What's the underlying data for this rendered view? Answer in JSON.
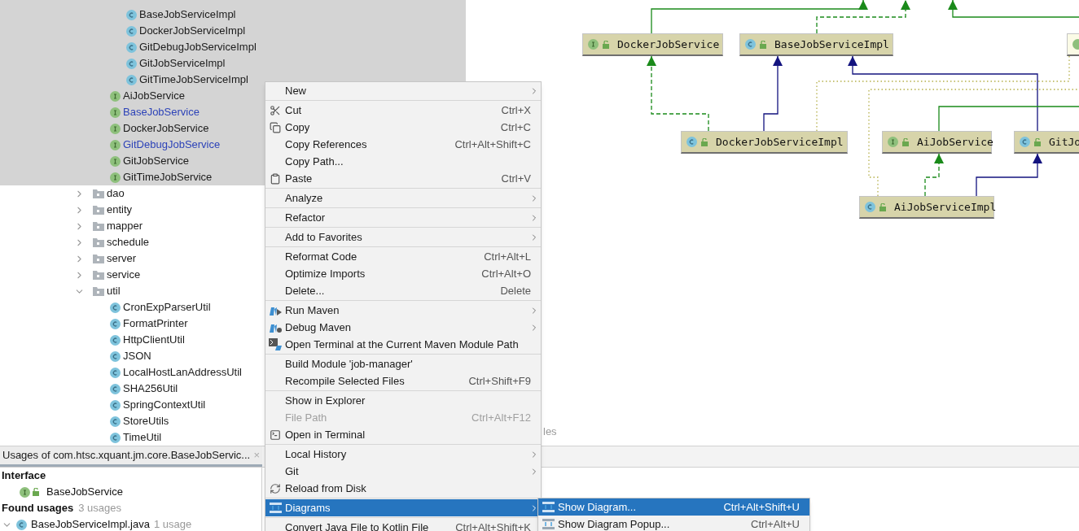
{
  "project_tree": {
    "items": [
      {
        "kind": "continuation",
        "children": [
          {
            "kind": "continuation",
            "children": [
              {
                "kind": "class",
                "label": "BaseJobServiceImpl",
                "selected": true,
                "modified": false
              },
              {
                "kind": "class",
                "label": "DockerJobServiceImpl",
                "selected": true,
                "modified": false
              },
              {
                "kind": "class",
                "label": "GitDebugJobServiceImpl",
                "selected": true,
                "modified": false
              },
              {
                "kind": "class",
                "label": "GitJobServiceImpl",
                "selected": true,
                "modified": false
              },
              {
                "kind": "class",
                "label": "GitTimeJobServiceImpl",
                "selected": true,
                "modified": false
              }
            ]
          },
          {
            "kind": "interface",
            "label": "AiJobService",
            "selected": true,
            "modified": false
          },
          {
            "kind": "interface",
            "label": "BaseJobService",
            "selected": true,
            "modified": true
          },
          {
            "kind": "interface",
            "label": "DockerJobService",
            "selected": true,
            "modified": false
          },
          {
            "kind": "interface",
            "label": "GitDebugJobService",
            "selected": true,
            "modified": true
          },
          {
            "kind": "interface",
            "label": "GitJobService",
            "selected": true,
            "modified": false
          },
          {
            "kind": "interface",
            "label": "GitTimeJobService",
            "selected": true,
            "modified": false
          }
        ]
      },
      {
        "kind": "folder",
        "label": "dao",
        "expanded": false,
        "selected": false,
        "modified": false
      },
      {
        "kind": "folder",
        "label": "entity",
        "expanded": false,
        "selected": false,
        "modified": false
      },
      {
        "kind": "folder",
        "label": "mapper",
        "expanded": false,
        "selected": false,
        "modified": false
      },
      {
        "kind": "folder",
        "label": "schedule",
        "expanded": false,
        "selected": false,
        "modified": false
      },
      {
        "kind": "folder",
        "label": "server",
        "expanded": false,
        "selected": false,
        "modified": false
      },
      {
        "kind": "folder",
        "label": "service",
        "expanded": false,
        "selected": false,
        "modified": false
      },
      {
        "kind": "folder",
        "label": "util",
        "expanded": true,
        "selected": false,
        "modified": false,
        "children": [
          {
            "kind": "class",
            "label": "CronExpParserUtil",
            "selected": false,
            "modified": false
          },
          {
            "kind": "class",
            "label": "FormatPrinter",
            "selected": false,
            "modified": false
          },
          {
            "kind": "class",
            "label": "HttpClientUtil",
            "selected": false,
            "modified": false
          },
          {
            "kind": "class",
            "label": "JSON",
            "selected": false,
            "modified": false
          },
          {
            "kind": "class",
            "label": "LocalHostLanAddressUtil",
            "selected": false,
            "modified": false
          },
          {
            "kind": "class",
            "label": "SHA256Util",
            "selected": false,
            "modified": false
          },
          {
            "kind": "class",
            "label": "SpringContextUtil",
            "selected": false,
            "modified": false
          },
          {
            "kind": "class",
            "label": "StoreUtils",
            "selected": false,
            "modified": false
          },
          {
            "kind": "class",
            "label": "TimeUtil",
            "selected": false,
            "modified": false
          }
        ]
      }
    ]
  },
  "diagram": {
    "nodes": [
      {
        "kind": "interface",
        "label": "DockerJobService"
      },
      {
        "kind": "class",
        "label": "BaseJobServiceImpl"
      },
      {
        "kind": "annotation"
      },
      {
        "kind": "class",
        "label": "DockerJobServiceImpl"
      },
      {
        "kind": "interface",
        "label": "AiJobService"
      },
      {
        "kind": "class",
        "label": "GitJo"
      },
      {
        "kind": "class",
        "label": "AiJobServiceImpl"
      }
    ],
    "hint": "les"
  },
  "usages_panel": {
    "tab": "Usages of com.htsc.xquant.jm.core.BaseJobServic...",
    "close": "×",
    "interface_heading": "Interface",
    "interface_item": "BaseJobService",
    "found_heading": "Found usages",
    "found_count": "3 usages",
    "file": {
      "label": "BaseJobServiceImpl.java",
      "count": "1 usage",
      "expanded": true
    }
  },
  "context_menu": {
    "groups": [
      {
        "items": [
          {
            "kind": "text",
            "label": "New",
            "submenu": true,
            "disabled": false,
            "selected": false
          }
        ]
      },
      {
        "items": [
          {
            "kind": "cut",
            "label": "Cut",
            "shortcut": "Ctrl+X",
            "submenu": false,
            "disabled": false,
            "selected": false
          },
          {
            "kind": "copy",
            "label": "Copy",
            "shortcut": "Ctrl+C",
            "submenu": false,
            "disabled": false,
            "selected": false
          },
          {
            "kind": "text",
            "label": "Copy References",
            "shortcut": "Ctrl+Alt+Shift+C",
            "submenu": false,
            "disabled": false,
            "selected": false
          },
          {
            "kind": "text",
            "label": "Copy Path...",
            "submenu": false,
            "disabled": false,
            "selected": false
          },
          {
            "kind": "paste",
            "label": "Paste",
            "shortcut": "Ctrl+V",
            "submenu": false,
            "disabled": false,
            "selected": false
          }
        ]
      },
      {
        "items": [
          {
            "kind": "text",
            "label": "Analyze",
            "submenu": true,
            "disabled": false,
            "selected": false
          }
        ]
      },
      {
        "items": [
          {
            "kind": "text",
            "label": "Refactor",
            "submenu": true,
            "disabled": false,
            "selected": false
          }
        ]
      },
      {
        "items": [
          {
            "kind": "text",
            "label": "Add to Favorites",
            "submenu": true,
            "disabled": false,
            "selected": false
          }
        ]
      },
      {
        "items": [
          {
            "kind": "text",
            "label": "Reformat Code",
            "shortcut": "Ctrl+Alt+L",
            "submenu": false,
            "disabled": false,
            "selected": false
          },
          {
            "kind": "text",
            "label": "Optimize Imports",
            "shortcut": "Ctrl+Alt+O",
            "submenu": false,
            "disabled": false,
            "selected": false
          },
          {
            "kind": "text",
            "label": "Delete...",
            "shortcut": "Delete",
            "submenu": false,
            "disabled": false,
            "selected": false
          }
        ]
      },
      {
        "items": [
          {
            "kind": "run",
            "label": "Run Maven",
            "submenu": true,
            "disabled": false,
            "selected": false
          },
          {
            "kind": "debug",
            "label": "Debug Maven",
            "submenu": true,
            "disabled": false,
            "selected": false
          },
          {
            "kind": "maventerminal",
            "label": "Open Terminal at the Current Maven Module Path",
            "submenu": false,
            "disabled": false,
            "selected": false
          }
        ]
      },
      {
        "items": [
          {
            "kind": "text",
            "label": "Build Module 'job-manager'",
            "submenu": false,
            "disabled": false,
            "selected": false
          },
          {
            "kind": "text",
            "label": "Recompile Selected Files",
            "shortcut": "Ctrl+Shift+F9",
            "submenu": false,
            "disabled": false,
            "selected": false
          }
        ]
      },
      {
        "items": [
          {
            "kind": "text",
            "label": "Show in Explorer",
            "submenu": false,
            "disabled": false,
            "selected": false
          },
          {
            "kind": "text",
            "label": "File Path",
            "shortcut": "Ctrl+Alt+F12",
            "submenu": false,
            "disabled": true,
            "selected": false
          },
          {
            "kind": "terminal",
            "label": "Open in Terminal",
            "submenu": false,
            "disabled": false,
            "selected": false
          }
        ]
      },
      {
        "items": [
          {
            "kind": "text",
            "label": "Local History",
            "submenu": true,
            "disabled": false,
            "selected": false
          },
          {
            "kind": "text",
            "label": "Git",
            "submenu": true,
            "disabled": false,
            "selected": false
          },
          {
            "kind": "reload",
            "label": "Reload from Disk",
            "submenu": false,
            "disabled": false,
            "selected": false
          }
        ]
      },
      {
        "items": [
          {
            "kind": "diagram",
            "label": "Diagrams",
            "submenu": true,
            "disabled": false,
            "selected": true
          }
        ]
      },
      {
        "items": [
          {
            "kind": "text",
            "label": "Convert Java File to Kotlin File",
            "shortcut": "Ctrl+Alt+Shift+K",
            "submenu": false,
            "disabled": false,
            "selected": false
          }
        ]
      }
    ]
  },
  "submenu": {
    "items": [
      {
        "label": "Show Diagram...",
        "shortcut": "Ctrl+Alt+Shift+U",
        "selected": true
      },
      {
        "label": "Show Diagram Popup...",
        "shortcut": "Ctrl+Alt+U",
        "selected": false
      }
    ]
  }
}
